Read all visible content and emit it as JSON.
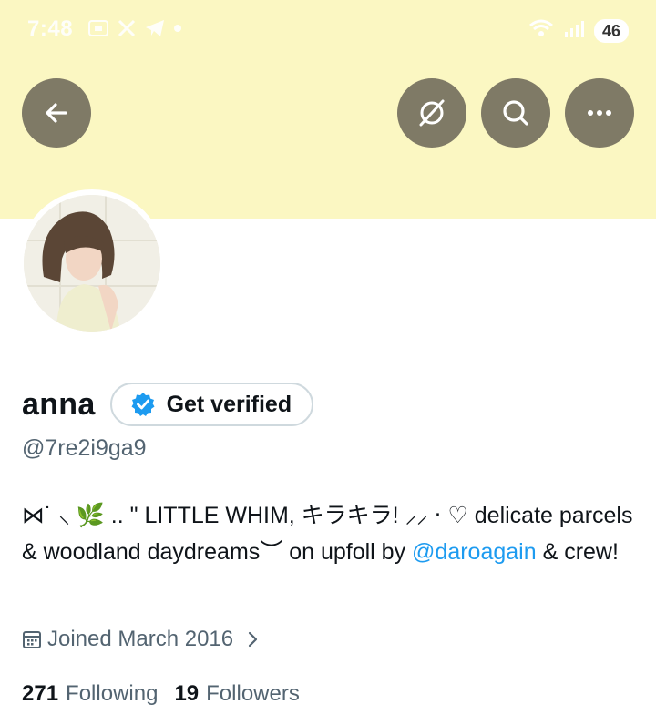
{
  "status_bar": {
    "time": "7:48",
    "battery": "46"
  },
  "header": {
    "back_icon": "arrow-left-icon",
    "grok_icon": "grok-icon",
    "search_icon": "search-icon",
    "more_icon": "more-horizontal-icon"
  },
  "profile": {
    "name": "anna",
    "verify_label": "Get verified",
    "handle": "@7re2i9ga9",
    "bio_part1": "⋈˙ ⸜ 🌿 .. \" LITTLE WHIM, キラキラ! ⸝⸝ ‧ ♡ delicate parcels & woodland daydreams︶ on upfoll by ",
    "bio_mention": "@daroagain",
    "bio_part2": " & crew!",
    "joined": "Joined March 2016",
    "following_count": "271",
    "following_label": "Following",
    "followers_count": "19",
    "followers_label": "Followers"
  },
  "colors": {
    "banner": "#fbf7c2",
    "button_bg": "#7f7a66",
    "link": "#1d9bf0",
    "verified_badge": "#1d9bf0",
    "secondary_text": "#536471"
  }
}
